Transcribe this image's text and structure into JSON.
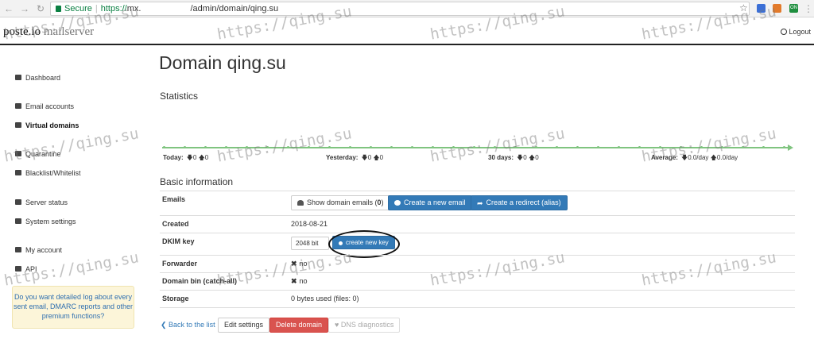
{
  "browser": {
    "secure_label": "Secure",
    "url_scheme": "https://",
    "url_host": "mx.",
    "url_path": "/admin/domain/qing.su",
    "ext_badge": "ON"
  },
  "header": {
    "brand_main": "poste.io",
    "brand_sub": "mailserver",
    "logout": "Logout"
  },
  "sidebar": {
    "items": [
      {
        "label": "Dashboard",
        "icon": "bar-chart-icon"
      },
      {
        "label": "Email accounts",
        "icon": "users-icon"
      },
      {
        "label": "Virtual domains",
        "icon": "list-icon"
      },
      {
        "label": "Quarantine",
        "icon": "biohazard-icon"
      },
      {
        "label": "Blacklist/Whitelist",
        "icon": "shield-icon"
      },
      {
        "label": "Server status",
        "icon": "heartbeat-icon"
      },
      {
        "label": "System settings",
        "icon": "gear-icon"
      },
      {
        "label": "My account",
        "icon": "user-icon"
      },
      {
        "label": "API",
        "icon": "exchange-icon"
      }
    ],
    "promo": "Do you want detailed log about every sent email, DMARC reports and other premium functions?"
  },
  "main": {
    "title": "Domain qing.su",
    "statistics_heading": "Statistics",
    "stats": [
      {
        "label": "Today:",
        "down": "0",
        "up": "0"
      },
      {
        "label": "Yesterday:",
        "down": "0",
        "up": "0"
      },
      {
        "label": "30 days:",
        "down": "0",
        "up": "0"
      },
      {
        "label": "Average:",
        "down": "0.0/day",
        "up": "0.0/day"
      }
    ],
    "basic_heading": "Basic information",
    "rows": {
      "emails_label": "Emails",
      "show_emails_btn": "Show domain emails (",
      "show_emails_count": "0",
      "show_emails_close": ")",
      "create_email_btn": "Create a new email",
      "create_redirect_btn": "Create a redirect (alias)",
      "created_label": "Created",
      "created_value": "2018-08-21",
      "dkim_label": "DKIM key",
      "dkim_bits": "2048 bit",
      "dkim_btn": "create new key",
      "forwarder_label": "Forwarder",
      "forwarder_value": "no",
      "bin_label": "Domain bin (catch-all)",
      "bin_value": "no",
      "storage_label": "Storage",
      "storage_value": "0 bytes used (files: 0)"
    },
    "actions": {
      "back": "Back to the list",
      "edit": "Edit settings",
      "delete": "Delete domain",
      "dns": "DNS diagnostics"
    }
  },
  "watermark": "https://qing.su",
  "colors": {
    "primary": "#337ab7",
    "danger": "#d9534f",
    "chart": "#7fc47f",
    "secure": "#0b8043",
    "promo_bg": "#fcf5d9"
  }
}
